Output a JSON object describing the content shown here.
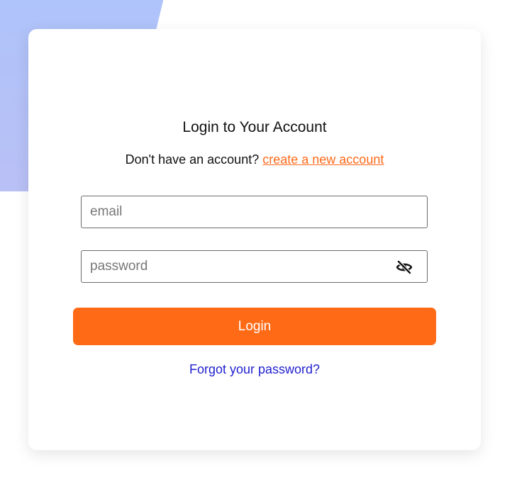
{
  "login": {
    "title": "Login to Your Account",
    "signup_prompt": "Don't have an account?",
    "signup_link": "create a new account",
    "email_placeholder": "email",
    "password_placeholder": "password",
    "password_toggle_icon": "eye-slash-icon",
    "login_button": "Login",
    "forgot_password": "Forgot your password?"
  },
  "colors": {
    "accent": "#ff6a16",
    "link": "#1f1fcf",
    "background_shape": "#adc4fb"
  }
}
